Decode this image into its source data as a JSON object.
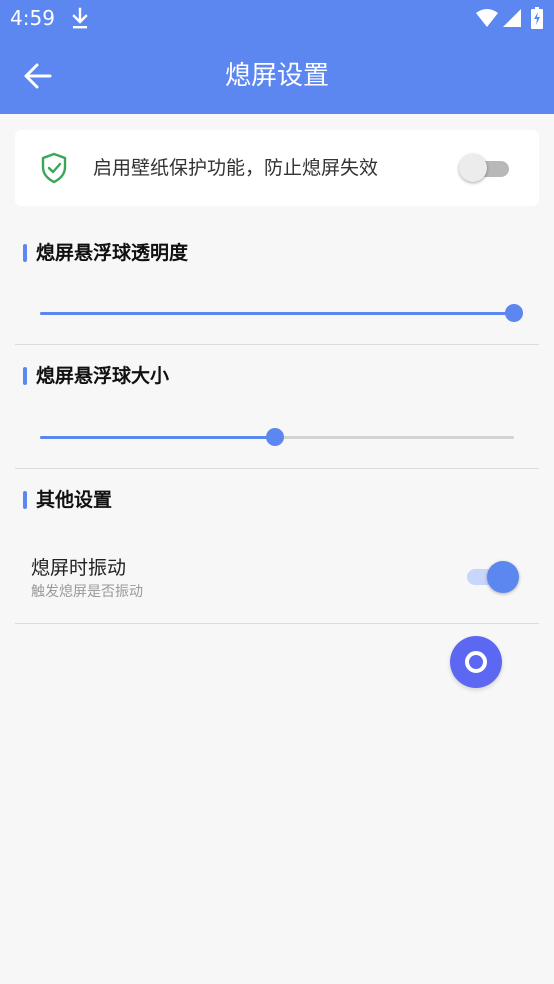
{
  "status_bar": {
    "time": "4:59",
    "icons": [
      "download-icon",
      "wifi-icon",
      "signal-icon",
      "battery-icon"
    ]
  },
  "header": {
    "title": "熄屏设置",
    "back_icon": "arrow-left-icon",
    "color": "#5c86f0"
  },
  "wallpaper_protect": {
    "label": "启用壁纸保护功能，防止熄屏失效",
    "icon": "shield-check-icon",
    "enabled": false
  },
  "sections": {
    "opacity": {
      "title": "熄屏悬浮球透明度",
      "value_fraction": 1.0
    },
    "size": {
      "title": "熄屏悬浮球大小",
      "value_fraction": 0.495
    },
    "other": {
      "title": "其他设置",
      "vibrate": {
        "title": "熄屏时振动",
        "subtitle": "触发熄屏是否振动",
        "enabled": true
      }
    }
  },
  "fab": {
    "icon": "ring-icon",
    "color": "#5d68f2"
  }
}
